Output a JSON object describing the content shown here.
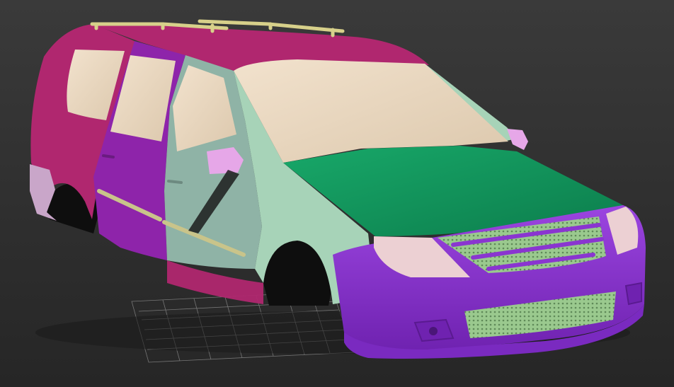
{
  "viewport": {
    "background_top": "#3a3a3a",
    "background_bottom": "#262626",
    "grid_color": "#8a8a8a"
  },
  "model": {
    "roof_color": "#b0276f",
    "rear_panel_color": "#b0276f",
    "rear_door_color": "#8e24aa",
    "front_door_color": "#8fb3a6",
    "fender_color": "#a7d3b8",
    "hood_color": "#13935c",
    "bumper_color": "#8a35d0",
    "glass_color": "#ebd9c2",
    "mirror_color": "#e6a7e8",
    "grille_color": "#9ac98e",
    "roof_rail_color": "#d7d08a",
    "trim_strip_color": "#c9c48a",
    "headlight_color": "#ecd0d3"
  }
}
